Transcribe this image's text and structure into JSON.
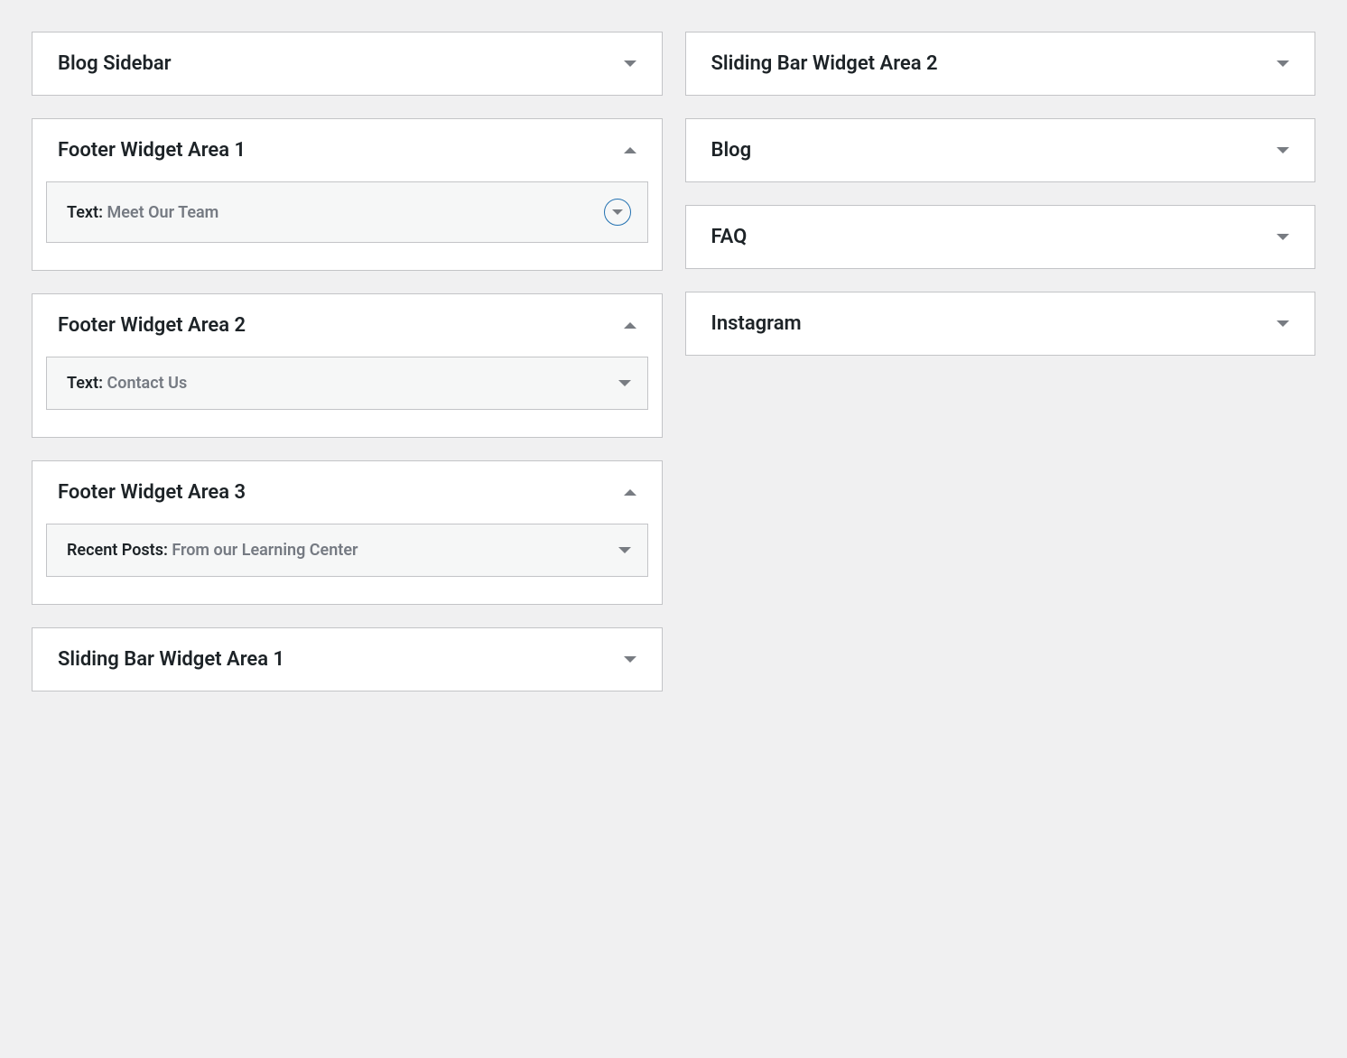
{
  "leftColumn": [
    {
      "title": "Blog Sidebar",
      "expanded": false
    },
    {
      "title": "Footer Widget Area 1",
      "expanded": true,
      "widgets": [
        {
          "type": "Text",
          "name": "Meet Our Team",
          "highlighted": true
        }
      ]
    },
    {
      "title": "Footer Widget Area 2",
      "expanded": true,
      "widgets": [
        {
          "type": "Text",
          "name": "Contact Us",
          "highlighted": false
        }
      ]
    },
    {
      "title": "Footer Widget Area 3",
      "expanded": true,
      "widgets": [
        {
          "type": "Recent Posts",
          "name": "From our Learning Center",
          "highlighted": false
        }
      ]
    },
    {
      "title": "Sliding Bar Widget Area 1",
      "expanded": false
    }
  ],
  "rightColumn": [
    {
      "title": "Sliding Bar Widget Area 2",
      "expanded": false
    },
    {
      "title": "Blog",
      "expanded": false
    },
    {
      "title": "FAQ",
      "expanded": false
    },
    {
      "title": "Instagram",
      "expanded": false
    }
  ]
}
